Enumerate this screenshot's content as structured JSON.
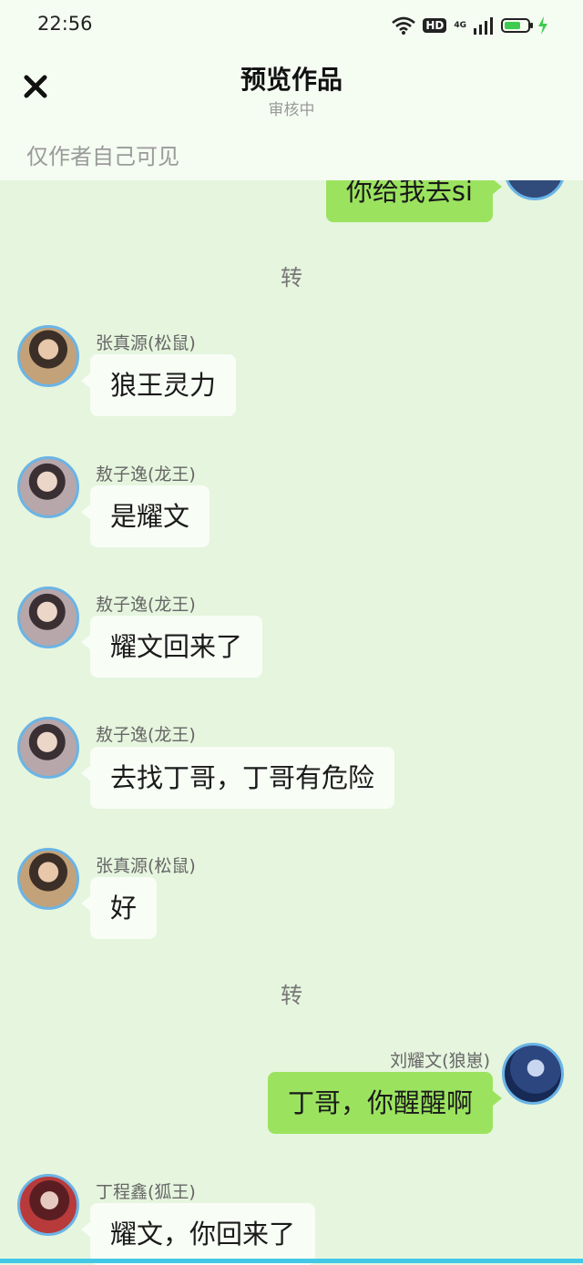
{
  "status_bar": {
    "time": "22:56",
    "hd": "HD",
    "network": "4G"
  },
  "header": {
    "title": "预览作品",
    "subtitle": "审核中",
    "notice": "仅作者自己可见"
  },
  "messages": [
    {
      "text": "你给我去si"
    },
    {
      "divider": "转"
    },
    {
      "name": "张真源(松鼠)",
      "text": "狼王灵力"
    },
    {
      "name": "敖子逸(龙王)",
      "text": "是耀文"
    },
    {
      "name": "敖子逸(龙王)",
      "text": "耀文回来了"
    },
    {
      "name": "敖子逸(龙王)",
      "text": "去找丁哥，丁哥有危险"
    },
    {
      "name": "张真源(松鼠)",
      "text": "好"
    },
    {
      "divider": "转"
    },
    {
      "name": "刘耀文(狼崽)",
      "text": "丁哥，你醒醒啊"
    },
    {
      "name": "丁程鑫(狐王)",
      "text": "耀文，你回来了"
    }
  ],
  "colors": {
    "background": "#e6f5de",
    "right_bubble": "#9be35f",
    "left_bubble": "#f8fdf6",
    "avatar_border": "#6ab4e6"
  }
}
